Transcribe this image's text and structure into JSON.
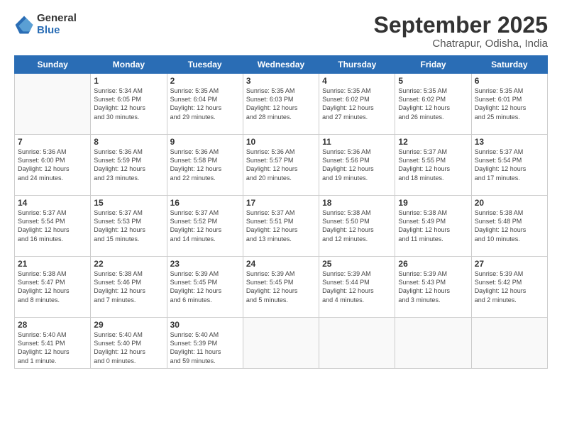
{
  "logo": {
    "general": "General",
    "blue": "Blue"
  },
  "header": {
    "month": "September 2025",
    "location": "Chatrapur, Odisha, India"
  },
  "days": [
    "Sunday",
    "Monday",
    "Tuesday",
    "Wednesday",
    "Thursday",
    "Friday",
    "Saturday"
  ],
  "weeks": [
    [
      {
        "num": "",
        "info": ""
      },
      {
        "num": "1",
        "info": "Sunrise: 5:34 AM\nSunset: 6:05 PM\nDaylight: 12 hours\nand 30 minutes."
      },
      {
        "num": "2",
        "info": "Sunrise: 5:35 AM\nSunset: 6:04 PM\nDaylight: 12 hours\nand 29 minutes."
      },
      {
        "num": "3",
        "info": "Sunrise: 5:35 AM\nSunset: 6:03 PM\nDaylight: 12 hours\nand 28 minutes."
      },
      {
        "num": "4",
        "info": "Sunrise: 5:35 AM\nSunset: 6:02 PM\nDaylight: 12 hours\nand 27 minutes."
      },
      {
        "num": "5",
        "info": "Sunrise: 5:35 AM\nSunset: 6:02 PM\nDaylight: 12 hours\nand 26 minutes."
      },
      {
        "num": "6",
        "info": "Sunrise: 5:35 AM\nSunset: 6:01 PM\nDaylight: 12 hours\nand 25 minutes."
      }
    ],
    [
      {
        "num": "7",
        "info": "Sunrise: 5:36 AM\nSunset: 6:00 PM\nDaylight: 12 hours\nand 24 minutes."
      },
      {
        "num": "8",
        "info": "Sunrise: 5:36 AM\nSunset: 5:59 PM\nDaylight: 12 hours\nand 23 minutes."
      },
      {
        "num": "9",
        "info": "Sunrise: 5:36 AM\nSunset: 5:58 PM\nDaylight: 12 hours\nand 22 minutes."
      },
      {
        "num": "10",
        "info": "Sunrise: 5:36 AM\nSunset: 5:57 PM\nDaylight: 12 hours\nand 20 minutes."
      },
      {
        "num": "11",
        "info": "Sunrise: 5:36 AM\nSunset: 5:56 PM\nDaylight: 12 hours\nand 19 minutes."
      },
      {
        "num": "12",
        "info": "Sunrise: 5:37 AM\nSunset: 5:55 PM\nDaylight: 12 hours\nand 18 minutes."
      },
      {
        "num": "13",
        "info": "Sunrise: 5:37 AM\nSunset: 5:54 PM\nDaylight: 12 hours\nand 17 minutes."
      }
    ],
    [
      {
        "num": "14",
        "info": "Sunrise: 5:37 AM\nSunset: 5:54 PM\nDaylight: 12 hours\nand 16 minutes."
      },
      {
        "num": "15",
        "info": "Sunrise: 5:37 AM\nSunset: 5:53 PM\nDaylight: 12 hours\nand 15 minutes."
      },
      {
        "num": "16",
        "info": "Sunrise: 5:37 AM\nSunset: 5:52 PM\nDaylight: 12 hours\nand 14 minutes."
      },
      {
        "num": "17",
        "info": "Sunrise: 5:37 AM\nSunset: 5:51 PM\nDaylight: 12 hours\nand 13 minutes."
      },
      {
        "num": "18",
        "info": "Sunrise: 5:38 AM\nSunset: 5:50 PM\nDaylight: 12 hours\nand 12 minutes."
      },
      {
        "num": "19",
        "info": "Sunrise: 5:38 AM\nSunset: 5:49 PM\nDaylight: 12 hours\nand 11 minutes."
      },
      {
        "num": "20",
        "info": "Sunrise: 5:38 AM\nSunset: 5:48 PM\nDaylight: 12 hours\nand 10 minutes."
      }
    ],
    [
      {
        "num": "21",
        "info": "Sunrise: 5:38 AM\nSunset: 5:47 PM\nDaylight: 12 hours\nand 8 minutes."
      },
      {
        "num": "22",
        "info": "Sunrise: 5:38 AM\nSunset: 5:46 PM\nDaylight: 12 hours\nand 7 minutes."
      },
      {
        "num": "23",
        "info": "Sunrise: 5:39 AM\nSunset: 5:45 PM\nDaylight: 12 hours\nand 6 minutes."
      },
      {
        "num": "24",
        "info": "Sunrise: 5:39 AM\nSunset: 5:45 PM\nDaylight: 12 hours\nand 5 minutes."
      },
      {
        "num": "25",
        "info": "Sunrise: 5:39 AM\nSunset: 5:44 PM\nDaylight: 12 hours\nand 4 minutes."
      },
      {
        "num": "26",
        "info": "Sunrise: 5:39 AM\nSunset: 5:43 PM\nDaylight: 12 hours\nand 3 minutes."
      },
      {
        "num": "27",
        "info": "Sunrise: 5:39 AM\nSunset: 5:42 PM\nDaylight: 12 hours\nand 2 minutes."
      }
    ],
    [
      {
        "num": "28",
        "info": "Sunrise: 5:40 AM\nSunset: 5:41 PM\nDaylight: 12 hours\nand 1 minute."
      },
      {
        "num": "29",
        "info": "Sunrise: 5:40 AM\nSunset: 5:40 PM\nDaylight: 12 hours\nand 0 minutes."
      },
      {
        "num": "30",
        "info": "Sunrise: 5:40 AM\nSunset: 5:39 PM\nDaylight: 11 hours\nand 59 minutes."
      },
      {
        "num": "",
        "info": ""
      },
      {
        "num": "",
        "info": ""
      },
      {
        "num": "",
        "info": ""
      },
      {
        "num": "",
        "info": ""
      }
    ]
  ]
}
